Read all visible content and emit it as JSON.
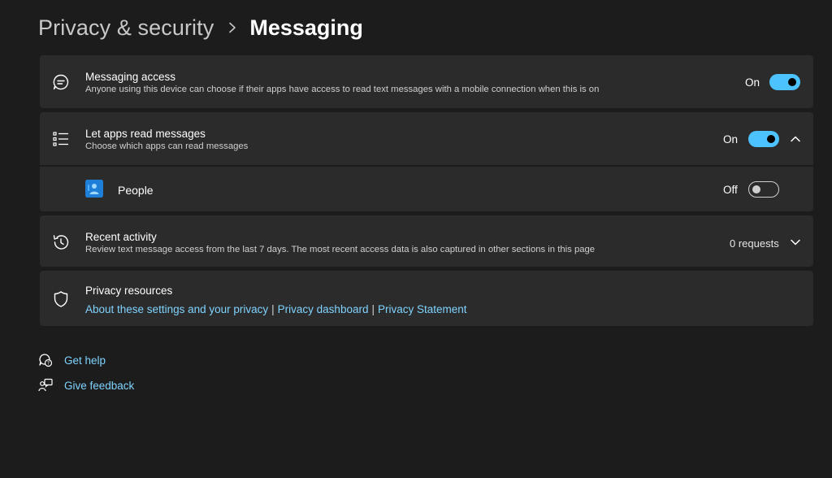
{
  "breadcrumb": {
    "parent": "Privacy & security",
    "current": "Messaging"
  },
  "messaging_access": {
    "title": "Messaging access",
    "description": "Anyone using this device can choose if their apps have access to read text messages with a mobile connection when this is on",
    "state": "On"
  },
  "let_apps": {
    "title": "Let apps read messages",
    "description": "Choose which apps can read messages",
    "state": "On"
  },
  "people_app": {
    "name": "People",
    "state": "Off"
  },
  "recent_activity": {
    "title": "Recent activity",
    "description": "Review text message access from the last 7 days. The most recent access data is also captured in other sections in this page",
    "count": "0 requests"
  },
  "privacy_resources": {
    "title": "Privacy resources",
    "links": [
      "About these settings and your privacy",
      "Privacy dashboard",
      "Privacy Statement"
    ],
    "separator": "|"
  },
  "footer": {
    "get_help": "Get help",
    "give_feedback": "Give feedback"
  },
  "colors": {
    "background": "#1c1c1c",
    "card": "#2b2b2b",
    "accent": "#4cc2ff",
    "link": "#7fd3ff"
  }
}
